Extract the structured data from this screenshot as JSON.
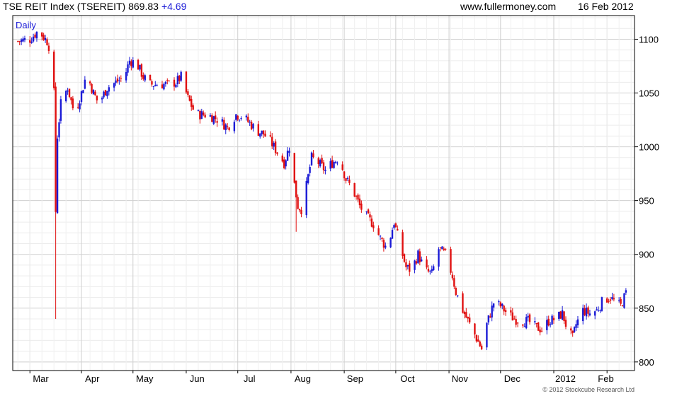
{
  "header": {
    "title": "TSE REIT Index (TSEREIT) 869.83",
    "change": "+4.69",
    "site": "www.fullermoney.com",
    "date": "16 Feb 2012"
  },
  "chart_data": {
    "type": "candlestick",
    "period_label": "Daily",
    "copyright": "© 2012 Stockcube Research Ltd",
    "ylim": [
      792,
      1122
    ],
    "y_ticks": [
      800,
      850,
      900,
      950,
      1000,
      1050,
      1100
    ],
    "x_ticks": [
      {
        "label": "Mar",
        "day": 0
      },
      {
        "label": "Apr",
        "day": 30
      },
      {
        "label": "May",
        "day": 60
      },
      {
        "label": "Jun",
        "day": 91
      },
      {
        "label": "Jul",
        "day": 121
      },
      {
        "label": "Aug",
        "day": 152
      },
      {
        "label": "Sep",
        "day": 183
      },
      {
        "label": "Oct",
        "day": 213
      },
      {
        "label": "Nov",
        "day": 244
      },
      {
        "label": "Dec",
        "day": 274
      },
      {
        "label": "2012",
        "day": 305
      },
      {
        "label": "Feb",
        "day": 336
      }
    ],
    "up_color": "#1a1ad6",
    "down_color": "#e01010",
    "grid": true,
    "close_path": [
      [
        -8,
        1098
      ],
      [
        0,
        1100
      ],
      [
        5,
        1108
      ],
      [
        10,
        1098
      ],
      [
        13,
        1085
      ],
      [
        14,
        1050
      ],
      [
        15,
        940
      ],
      [
        16,
        1010
      ],
      [
        18,
        1040
      ],
      [
        22,
        1055
      ],
      [
        26,
        1030
      ],
      [
        30,
        1050
      ],
      [
        33,
        1068
      ],
      [
        37,
        1050
      ],
      [
        40,
        1040
      ],
      [
        45,
        1055
      ],
      [
        50,
        1060
      ],
      [
        55,
        1065
      ],
      [
        58,
        1080
      ],
      [
        62,
        1078
      ],
      [
        66,
        1065
      ],
      [
        70,
        1058
      ],
      [
        75,
        1058
      ],
      [
        80,
        1058
      ],
      [
        85,
        1060
      ],
      [
        88,
        1065
      ],
      [
        92,
        1045
      ],
      [
        95,
        1035
      ],
      [
        98,
        1030
      ],
      [
        102,
        1030
      ],
      [
        106,
        1028
      ],
      [
        110,
        1025
      ],
      [
        115,
        1018
      ],
      [
        120,
        1030
      ],
      [
        124,
        1028
      ],
      [
        128,
        1022
      ],
      [
        132,
        1015
      ],
      [
        136,
        1012
      ],
      [
        140,
        1005
      ],
      [
        144,
        995
      ],
      [
        148,
        985
      ],
      [
        152,
        1005
      ],
      [
        154,
        965
      ],
      [
        156,
        945
      ],
      [
        158,
        942
      ],
      [
        160,
        955
      ],
      [
        164,
        990
      ],
      [
        168,
        985
      ],
      [
        172,
        978
      ],
      [
        176,
        985
      ],
      [
        180,
        990
      ],
      [
        184,
        970
      ],
      [
        188,
        960
      ],
      [
        192,
        945
      ],
      [
        196,
        935
      ],
      [
        200,
        928
      ],
      [
        204,
        915
      ],
      [
        208,
        905
      ],
      [
        212,
        930
      ],
      [
        216,
        905
      ],
      [
        219,
        888
      ],
      [
        222,
        885
      ],
      [
        226,
        900
      ],
      [
        230,
        885
      ],
      [
        234,
        882
      ],
      [
        238,
        905
      ],
      [
        242,
        900
      ],
      [
        246,
        880
      ],
      [
        248,
        865
      ],
      [
        252,
        848
      ],
      [
        256,
        835
      ],
      [
        260,
        822
      ],
      [
        263,
        812
      ],
      [
        266,
        835
      ],
      [
        270,
        855
      ],
      [
        274,
        852
      ],
      [
        278,
        845
      ],
      [
        282,
        840
      ],
      [
        286,
        838
      ],
      [
        290,
        838
      ],
      [
        294,
        833
      ],
      [
        298,
        830
      ],
      [
        302,
        838
      ],
      [
        306,
        840
      ],
      [
        310,
        845
      ],
      [
        313,
        830
      ],
      [
        316,
        822
      ],
      [
        318,
        835
      ],
      [
        322,
        848
      ],
      [
        326,
        845
      ],
      [
        330,
        848
      ],
      [
        334,
        858
      ],
      [
        338,
        860
      ],
      [
        341,
        855
      ],
      [
        344,
        852
      ],
      [
        346,
        860
      ],
      [
        348,
        868
      ]
    ]
  }
}
